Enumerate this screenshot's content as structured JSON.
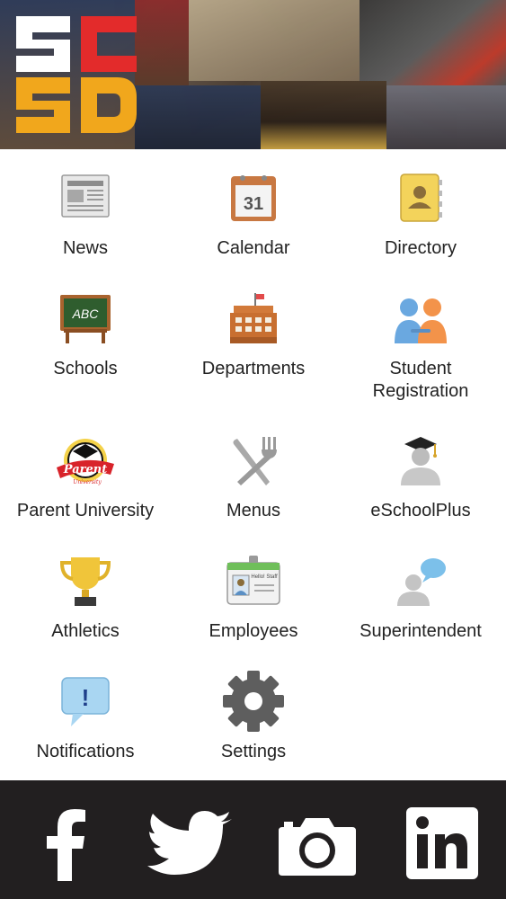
{
  "header": {
    "logo_icon": "scsd-logo",
    "logo_letters": [
      "S",
      "C",
      "S",
      "D"
    ],
    "colors": {
      "logo_white": "#ffffff",
      "logo_red": "#e32b2b",
      "logo_gold": "#f1a71c"
    }
  },
  "menu": {
    "items": [
      {
        "label": "News",
        "icon": "newspaper-icon"
      },
      {
        "label": "Calendar",
        "icon": "calendar-icon",
        "icon_text": "31"
      },
      {
        "label": "Directory",
        "icon": "address-book-icon"
      },
      {
        "label": "Schools",
        "icon": "chalkboard-icon",
        "icon_text": "ABC"
      },
      {
        "label": "Departments",
        "icon": "building-icon"
      },
      {
        "label_line1": "Student",
        "label_line2": "Registration",
        "icon": "people-icon"
      },
      {
        "label": "Parent University",
        "icon": "parent-university-logo-icon",
        "icon_text": "Parent",
        "icon_text2": "University"
      },
      {
        "label": "Menus",
        "icon": "fork-knife-icon"
      },
      {
        "label": "eSchoolPlus",
        "icon": "graduate-icon"
      },
      {
        "label": "Athletics",
        "icon": "trophy-icon"
      },
      {
        "label": "Employees",
        "icon": "id-badge-icon",
        "icon_text": "Hello! Staff"
      },
      {
        "label": "Superintendent",
        "icon": "speech-bubble-person-icon"
      },
      {
        "label": "Notifications",
        "icon": "alert-bubble-icon",
        "icon_text": "!"
      },
      {
        "label": "Settings",
        "icon": "gear-icon"
      }
    ]
  },
  "footer": {
    "links": [
      {
        "name": "facebook",
        "icon": "facebook-icon",
        "glyph": "f"
      },
      {
        "name": "twitter",
        "icon": "twitter-icon"
      },
      {
        "name": "instagram",
        "icon": "camera-icon"
      },
      {
        "name": "linkedin",
        "icon": "linkedin-icon",
        "glyph": "in"
      }
    ],
    "background": "#221f20"
  }
}
